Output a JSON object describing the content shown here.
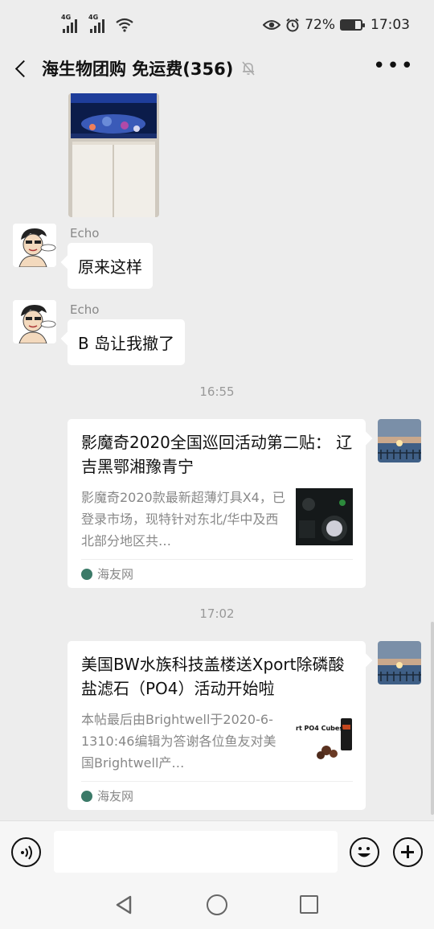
{
  "status_bar": {
    "network_1": "4G",
    "network_2": "4G",
    "battery_percent": "72%",
    "battery_level": 0.72,
    "time": "17:03",
    "icons": [
      "signal-icon",
      "signal-icon",
      "wifi-icon",
      "eye-icon",
      "alarm-icon",
      "battery-icon"
    ]
  },
  "header": {
    "title": "海生物团购 免运费(356)",
    "muted": true
  },
  "messages": [
    {
      "type": "image",
      "side": "left"
    },
    {
      "type": "text",
      "sender": "Echo",
      "text": "原来这样"
    },
    {
      "type": "text",
      "sender": "Echo",
      "text": "B 岛让我撤了"
    },
    {
      "type": "time",
      "text": "16:55"
    },
    {
      "type": "link_card",
      "side": "right",
      "title": "影魔奇2020全国巡回活动第二贴： 辽吉黑鄂湘豫青宁",
      "description": "影魔奇2020款最新超薄灯具X4，已登录市场，现特针对东北/华中及西北部分地区共…",
      "source": "海友网"
    },
    {
      "type": "time",
      "text": "17:02"
    },
    {
      "type": "link_card",
      "side": "right",
      "title": "美国BW水族科技盖楼送Xport除磷酸盐滤石（PO4）活动开始啦",
      "description": "本帖最后由Brightwell于2020-6-1310:46编辑为答谢各位鱼友对美国Brightwell产…",
      "source": "海友网",
      "thumb_text": "rt PO4 Cubes"
    }
  ],
  "input_bar": {
    "icons": [
      "voice-icon",
      "emoji-icon",
      "plus-icon"
    ],
    "placeholder": ""
  },
  "nav_bar": {
    "icons": [
      "back-triangle-icon",
      "home-circle-icon",
      "recent-square-icon"
    ]
  }
}
